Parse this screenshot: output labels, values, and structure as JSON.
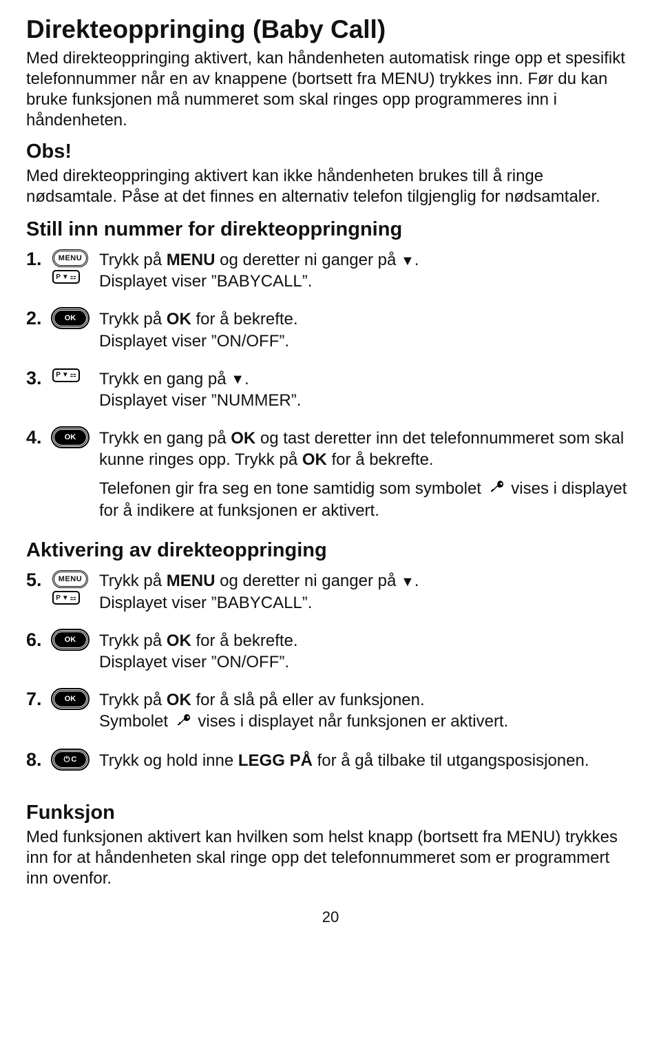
{
  "title": "Direkteoppringing (Baby Call)",
  "intro": "Med direkteoppringing aktivert, kan håndenheten automatisk ringe opp et spesifikt telefonnummer når en av knappene (bortsett fra MENU) trykkes inn. Før du kan bruke funksjonen må nummeret som skal ringes opp programmeres inn i håndenheten.",
  "obs_heading": "Obs!",
  "obs_text": "Med direkteoppringing aktivert kan ikke håndenheten brukes till å ringe nødsamtale. Påse at det finnes en alternativ telefon tilgjenglig for nødsamtaler.",
  "section1_title": "Still inn nummer for direkteoppringning",
  "steps1": {
    "s1": {
      "num": "1.",
      "line1a": "Trykk på ",
      "line1b": "MENU",
      "line1c": " og deretter ni ganger på ",
      "line1d": "▼",
      "line1e": ".",
      "line2": "Displayet viser ”BABYCALL”."
    },
    "s2": {
      "num": "2.",
      "line1a": "Trykk på ",
      "line1b": "OK",
      "line1c": " for å bekrefte.",
      "line2": "Displayet viser ”ON/OFF”."
    },
    "s3": {
      "num": "3.",
      "line1a": "Trykk en gang på ",
      "line1b": "▼",
      "line1c": ".",
      "line2": "Displayet viser ”NUMMER”."
    },
    "s4": {
      "num": "4.",
      "line1a": "Trykk en gang på ",
      "line1b": "OK",
      "line1c": " og tast deretter inn det telefonnummeret som skal kunne ringes opp. Trykk på ",
      "line1d": "OK",
      "line1e": " for å bekrefte.",
      "line2a": "Telefonen gir fra seg en tone samtidig som symbolet ",
      "line2b": " vises i displayet for å indikere at funksjonen er aktivert."
    }
  },
  "section2_title": "Aktivering av direkteoppringing",
  "steps2": {
    "s5": {
      "num": "5.",
      "line1a": "Trykk på ",
      "line1b": "MENU",
      "line1c": " og deretter ni ganger på ",
      "line1d": "▼",
      "line1e": ".",
      "line2": "Displayet viser ”BABYCALL”."
    },
    "s6": {
      "num": "6.",
      "line1a": "Trykk på ",
      "line1b": "OK",
      "line1c": " for å bekrefte.",
      "line2": "Displayet viser ”ON/OFF”."
    },
    "s7": {
      "num": "7.",
      "line1a": "Trykk på ",
      "line1b": "OK",
      "line1c": " for å slå på eller av funksjonen.",
      "line2a": "Symbolet ",
      "line2b": " vises i displayet når funksjonen er aktivert."
    },
    "s8": {
      "num": "8.",
      "line1a": "Trykk og hold inne ",
      "line1b": "LEGG PÅ",
      "line1c": " for å gå tilbake til utgangsposisjonen."
    }
  },
  "funksjon_heading": "Funksjon",
  "funksjon_text": "Med funksjonen aktivert kan hvilken som helst knapp (bortsett fra MENU) trykkes inn for at håndenheten skal ringe opp det telefonnummeret som er programmert inn ovenfor.",
  "page_number": "20",
  "icons": {
    "menu": "MENU",
    "ok": "OK",
    "nav_p": "P",
    "power": "⏻",
    "c": "C"
  }
}
